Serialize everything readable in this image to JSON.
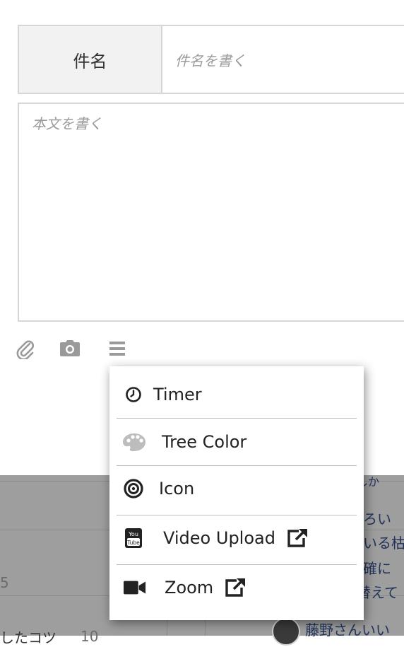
{
  "form": {
    "subject_label": "件名",
    "subject_placeholder": "件名を書く",
    "body_placeholder": "本文を書く"
  },
  "toolbar": {
    "icons": [
      "paperclip-icon",
      "camera-icon",
      "hamburger-icon"
    ]
  },
  "menu": {
    "items": [
      {
        "label": "Timer",
        "icon": "clock-icon"
      },
      {
        "label": "Tree Color",
        "icon": "palette-icon"
      },
      {
        "label": "Icon",
        "icon": "bullseye-icon"
      },
      {
        "label": "Video Upload",
        "icon": "youtube-icon",
        "external": true
      },
      {
        "label": "Zoom",
        "icon": "video-camera-icon",
        "external": true
      }
    ]
  },
  "background": {
    "snippets": [
      "しか",
      "ろい",
      "いる枯",
      "確に",
      "替えて",
      "藤野さんいい",
      "5",
      "10",
      "したコツ"
    ]
  }
}
